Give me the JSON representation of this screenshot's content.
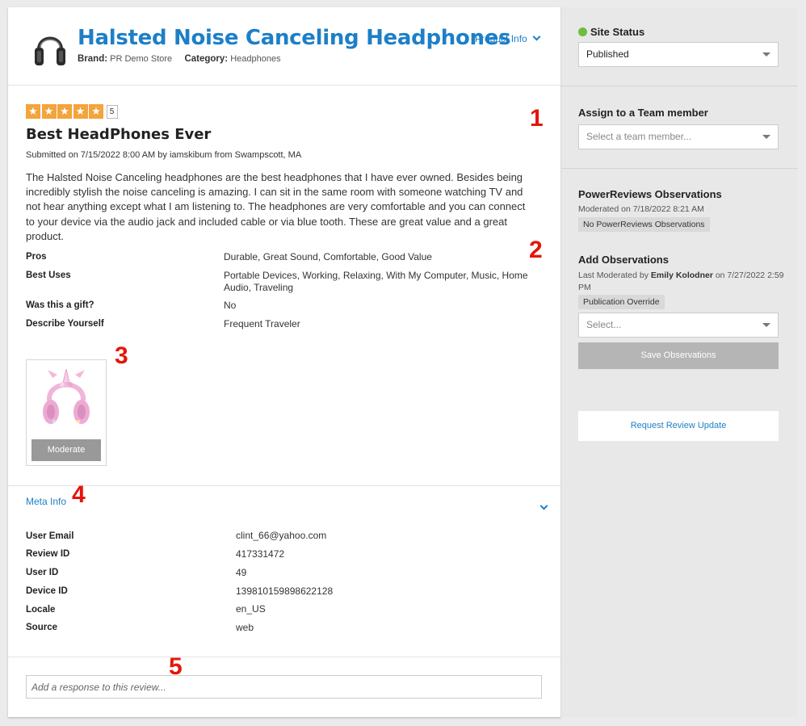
{
  "product": {
    "title": "Halsted Noise Canceling Headphones",
    "brand_label": "Brand:",
    "brand": "PR Demo Store",
    "category_label": "Category:",
    "category": "Headphones",
    "product_info_link": "Product Info"
  },
  "review": {
    "rating": 5,
    "rating_label": "5",
    "title": "Best HeadPhones Ever",
    "submitted": "Submitted on 7/15/2022 8:00 AM by iamskibum from Swampscott, MA",
    "body": "The Halsted Noise Canceling headphones are the best headphones that I have ever owned. Besides being incredibly stylish the noise canceling is amazing. I can sit in the same room with someone watching TV and not hear anything except what I am listening to. The headphones are very comfortable and you can connect to your device via the audio jack and included cable or via blue tooth. These are great value and a great product.",
    "attributes": [
      {
        "label": "Pros",
        "value": "Durable, Great Sound, Comfortable, Good Value"
      },
      {
        "label": "Best Uses",
        "value": "Portable Devices, Working, Relaxing, With My Computer, Music, Home Audio, Traveling"
      },
      {
        "label": "Was this a gift?",
        "value": "No"
      },
      {
        "label": "Describe Yourself",
        "value": "Frequent Traveler"
      }
    ],
    "moderate_button": "Moderate"
  },
  "meta": {
    "toggle_label": "Meta Info",
    "rows": [
      {
        "label": "User Email",
        "value": "clint_66@yahoo.com"
      },
      {
        "label": "Review ID",
        "value": "417331472"
      },
      {
        "label": "User ID",
        "value": "49"
      },
      {
        "label": "Device ID",
        "value": "139810159898622128"
      },
      {
        "label": "Locale",
        "value": "en_US"
      },
      {
        "label": "Source",
        "value": "web"
      }
    ]
  },
  "response": {
    "placeholder": "Add a response to this review..."
  },
  "annotations": [
    "1",
    "2",
    "3",
    "4",
    "5"
  ],
  "sidebar": {
    "site_status_heading": "Site Status",
    "site_status_value": "Published",
    "assign_heading": "Assign to a Team member",
    "assign_placeholder": "Select a team member...",
    "observations_heading": "PowerReviews Observations",
    "observations_moderated": "Moderated on 7/18/2022 8:21 AM",
    "observations_tag": "No PowerReviews Observations",
    "add_obs_heading": "Add Observations",
    "add_obs_last_prefix": "Last Moderated by",
    "add_obs_last_name": "Emily Kolodner",
    "add_obs_last_date": "on 7/27/2022",
    "add_obs_last_time": "2:59 PM",
    "add_obs_tag": "Publication Override",
    "add_obs_select": "Select...",
    "save_button": "Save Observations",
    "request_button": "Request Review Update"
  },
  "colors": {
    "link_blue": "#1d7fc7",
    "star_orange": "#f3a43c",
    "status_green": "#6dbf3b",
    "annotation_red": "#e3170a"
  }
}
